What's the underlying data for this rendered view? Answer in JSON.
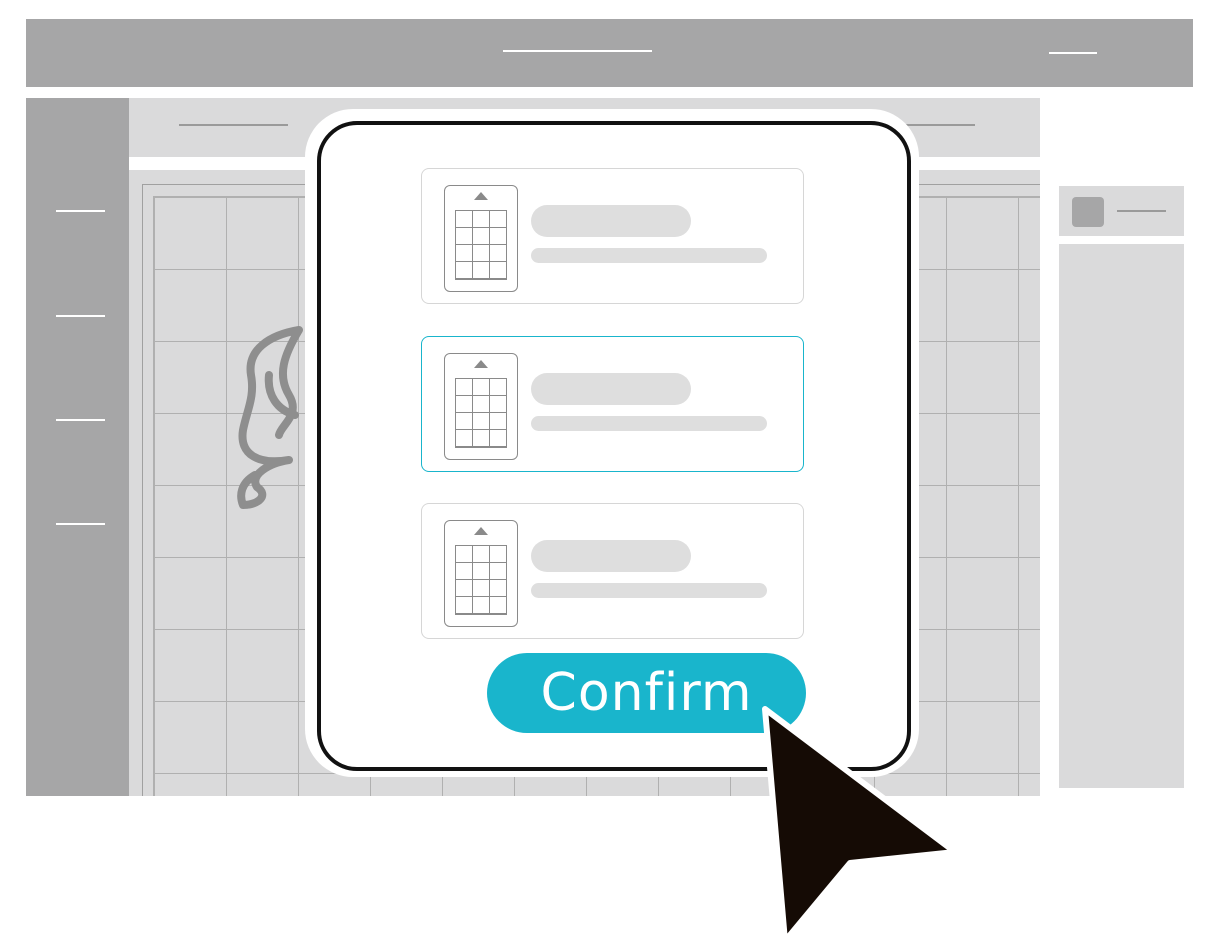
{
  "confirm_dialog": {
    "confirm_label": "Confirm",
    "mat_options": [
      {
        "selected": false
      },
      {
        "selected": true
      },
      {
        "selected": false
      }
    ]
  },
  "colors": {
    "accent": "#19b5cc",
    "chrome_gray": "#a6a6a7",
    "panel_gray": "#dadadb",
    "modal_border": "#111111",
    "cursor": "#150b05"
  },
  "icons": [
    "mat-icon",
    "cut-shape-icon",
    "pointer-cursor-icon"
  ]
}
